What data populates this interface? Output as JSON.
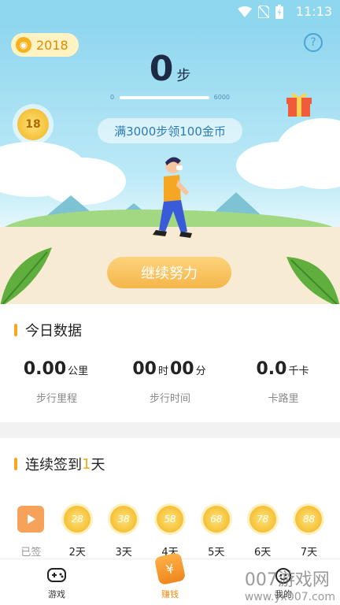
{
  "status_bar": {
    "time": "11:13"
  },
  "hero": {
    "coins": "2018",
    "steps": "0",
    "steps_unit": "步",
    "progress_min": "0",
    "progress_max": "6000",
    "progress_fraction": 0,
    "floating_coin": "18",
    "tip": "满3000步领100金币",
    "continue_label": "继续努力"
  },
  "today": {
    "title": "今日数据",
    "distance": {
      "value": "0.00",
      "unit": "公里",
      "label": "步行里程"
    },
    "time": {
      "hours": "00",
      "hours_unit": "时",
      "minutes": "00",
      "minutes_unit": "分",
      "label": "步行时间"
    },
    "calories": {
      "value": "0.0",
      "unit": "千卡",
      "label": "卡路里"
    }
  },
  "checkin": {
    "title_prefix": "连续签到",
    "title_days": "1",
    "title_suffix": "天",
    "days": [
      {
        "coin": "",
        "label": "已签",
        "done": true
      },
      {
        "coin": "28",
        "label": "2天"
      },
      {
        "coin": "38",
        "label": "3天"
      },
      {
        "coin": "58",
        "label": "4天"
      },
      {
        "coin": "68",
        "label": "5天"
      },
      {
        "coin": "78",
        "label": "6天"
      },
      {
        "coin": "88",
        "label": "7天"
      }
    ]
  },
  "bottom_nav": {
    "games": "游戏",
    "earn": "赚钱",
    "mine": "我的",
    "earn_icon_glyph": "¥"
  },
  "watermark": {
    "line1": "007游戏网",
    "line2": "www.yx007.com"
  }
}
